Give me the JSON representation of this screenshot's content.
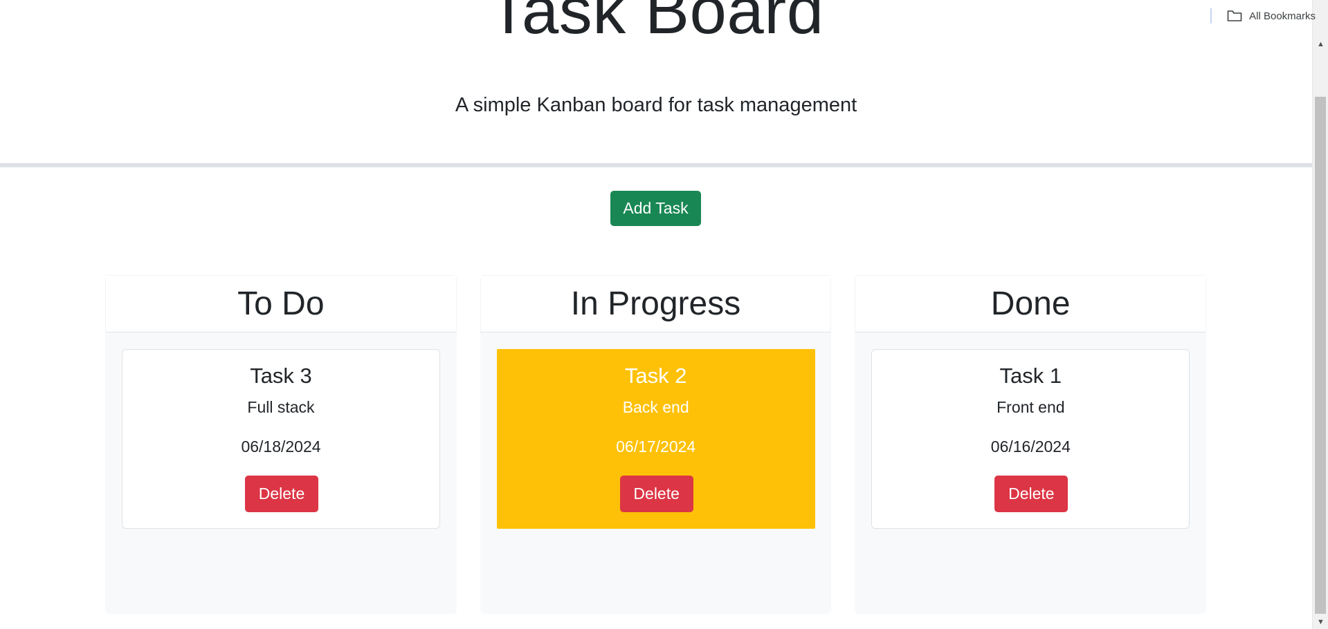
{
  "bookmarks": {
    "label": "All Bookmarks",
    "icon": "folder-icon"
  },
  "header": {
    "title": "Task Board",
    "subtitle": "A simple Kanban board for task management"
  },
  "toolbar": {
    "add_task_label": "Add Task"
  },
  "colors": {
    "add_button": "#198754",
    "delete_button": "#dc3545",
    "in_progress_card": "#ffc107",
    "column_background": "#f8f9fa"
  },
  "columns": [
    {
      "title": "To Do",
      "tasks": [
        {
          "name": "Task 3",
          "description": "Full stack",
          "date": "06/18/2024",
          "delete_label": "Delete"
        }
      ]
    },
    {
      "title": "In Progress",
      "tasks": [
        {
          "name": "Task 2",
          "description": "Back end",
          "date": "06/17/2024",
          "delete_label": "Delete"
        }
      ]
    },
    {
      "title": "Done",
      "tasks": [
        {
          "name": "Task 1",
          "description": "Front end",
          "date": "06/16/2024",
          "delete_label": "Delete"
        }
      ]
    }
  ]
}
